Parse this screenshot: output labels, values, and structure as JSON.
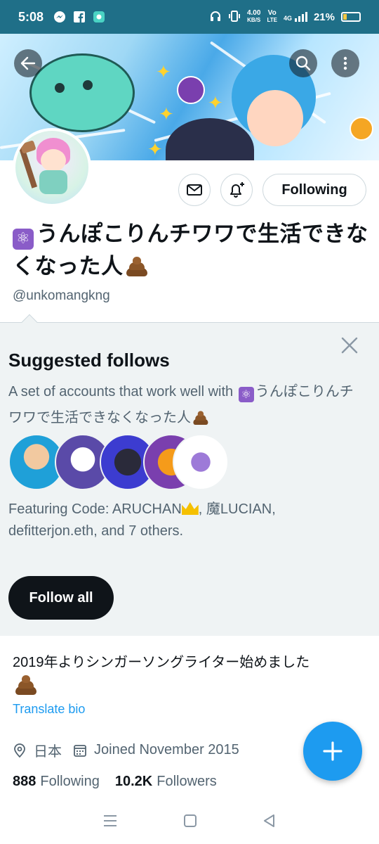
{
  "status_bar": {
    "time": "5:08",
    "speed_value": "4.00",
    "speed_unit": "KB/S",
    "volte_top": "Vo",
    "volte_bottom": "LTE",
    "network": "4G",
    "battery": "21%",
    "icons": [
      "messenger-icon",
      "facebook-icon",
      "app-icon",
      "headphones-icon",
      "vibrate-icon",
      "signal-icon",
      "battery-icon"
    ]
  },
  "header": {
    "back_icon": "arrow-left-icon",
    "search_icon": "search-icon",
    "more_icon": "more-vertical-icon"
  },
  "profile": {
    "display_name": "うんぽこりんチワワで生活できなくなった人",
    "handle": "@unkomangkng",
    "following_button": "Following",
    "bio_line": "2019年よりシンガーソングライター始めました",
    "translate_bio": "Translate bio",
    "location": "日本",
    "joined": "Joined November 2015",
    "following_count": "888",
    "following_label": "Following",
    "followers_count": "10.2K",
    "followers_label": "Followers"
  },
  "suggested": {
    "title": "Suggested follows",
    "description_prefix": "A set of accounts that work well with ",
    "description_name": "うんぽこりんチワワで生活できなくなった人",
    "featuring_prefix": "Featuring Code: ARUCHAN",
    "featuring_rest": ", 魔LUCIAN, defitterjon.eth, and 7 others.",
    "follow_all": "Follow all"
  },
  "colors": {
    "accent": "#1d9bf0",
    "status_bar": "#1f6f88",
    "panel_bg": "#eff3f4",
    "text_primary": "#0f1419",
    "text_secondary": "#536471"
  }
}
